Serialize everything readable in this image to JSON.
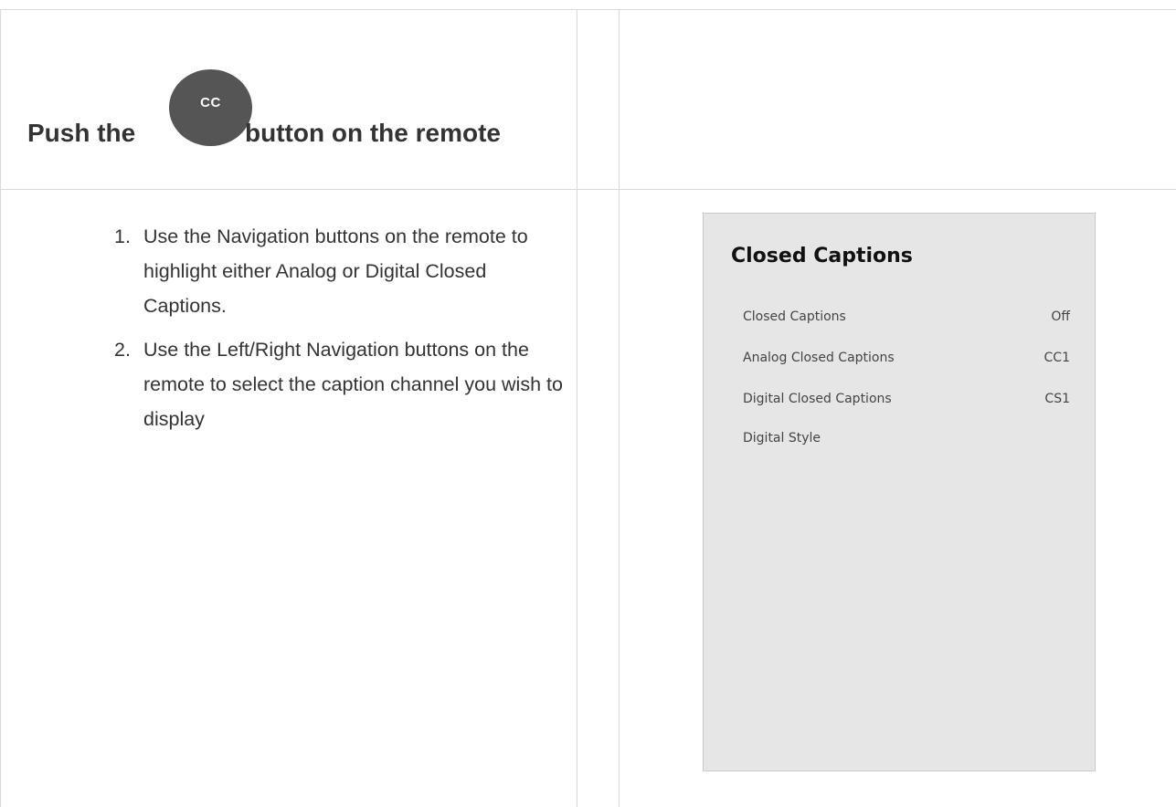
{
  "heading": {
    "pre": "Push the",
    "button_label": "CC",
    "post": "button on the remote"
  },
  "steps": [
    {
      "num": "1.",
      "text": "Use the Navigation buttons on the remote to highlight either Analog or Digital Closed Captions."
    },
    {
      "num": "2.",
      "text": "Use the Left/Right Navigation buttons on the remote to select the caption channel you wish to display"
    }
  ],
  "menu": {
    "title": "Closed Captions",
    "rows": [
      {
        "label": "Closed Captions",
        "value": "Off"
      },
      {
        "label": "Analog Closed Captions",
        "value": "CC1"
      },
      {
        "label": "Digital Closed Captions",
        "value": "CS1"
      },
      {
        "label": "Digital Style",
        "value": ""
      }
    ]
  },
  "colors": {
    "badge": "#555555",
    "menu_bg": "#e6e6e6",
    "grid_line": "#dadada"
  }
}
